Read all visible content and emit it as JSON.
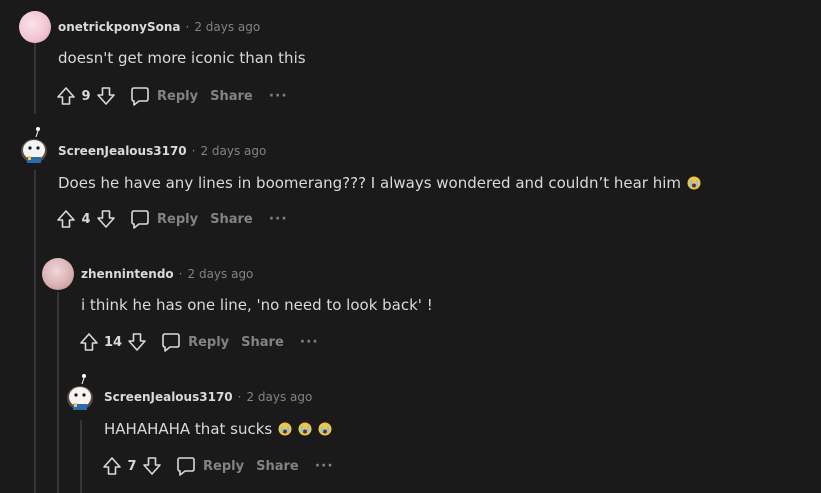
{
  "comments": [
    {
      "username": "onetrickponySona",
      "time": "2 days ago",
      "text": "doesn't get more iconic than this",
      "score": "9",
      "emoji_count": 0
    },
    {
      "username": "ScreenJealous3170",
      "time": "2 days ago",
      "text": "Does he have any lines in boomerang??? I always wondered and couldn’t hear him",
      "score": "4",
      "emoji_count": 1
    },
    {
      "username": "zhennintendo",
      "time": "2 days ago",
      "text": "i think he has one line, 'no need to look back' !",
      "score": "14",
      "emoji_count": 0
    },
    {
      "username": "ScreenJealous3170",
      "time": "2 days ago",
      "text": "HAHAHAHA that sucks",
      "score": "7",
      "emoji_count": 3
    }
  ],
  "labels": {
    "separator": "·",
    "reply": "Reply",
    "share": "Share",
    "more": "···"
  },
  "icons": {
    "upvote": "upvote-icon",
    "downvote": "downvote-icon",
    "reply": "comment-bubble-icon",
    "emoji": "crying-face-emoji"
  },
  "colors": {
    "background": "#1a1a1b",
    "text": "#d7dadc",
    "muted": "#818384",
    "thread_line": "#343536"
  }
}
